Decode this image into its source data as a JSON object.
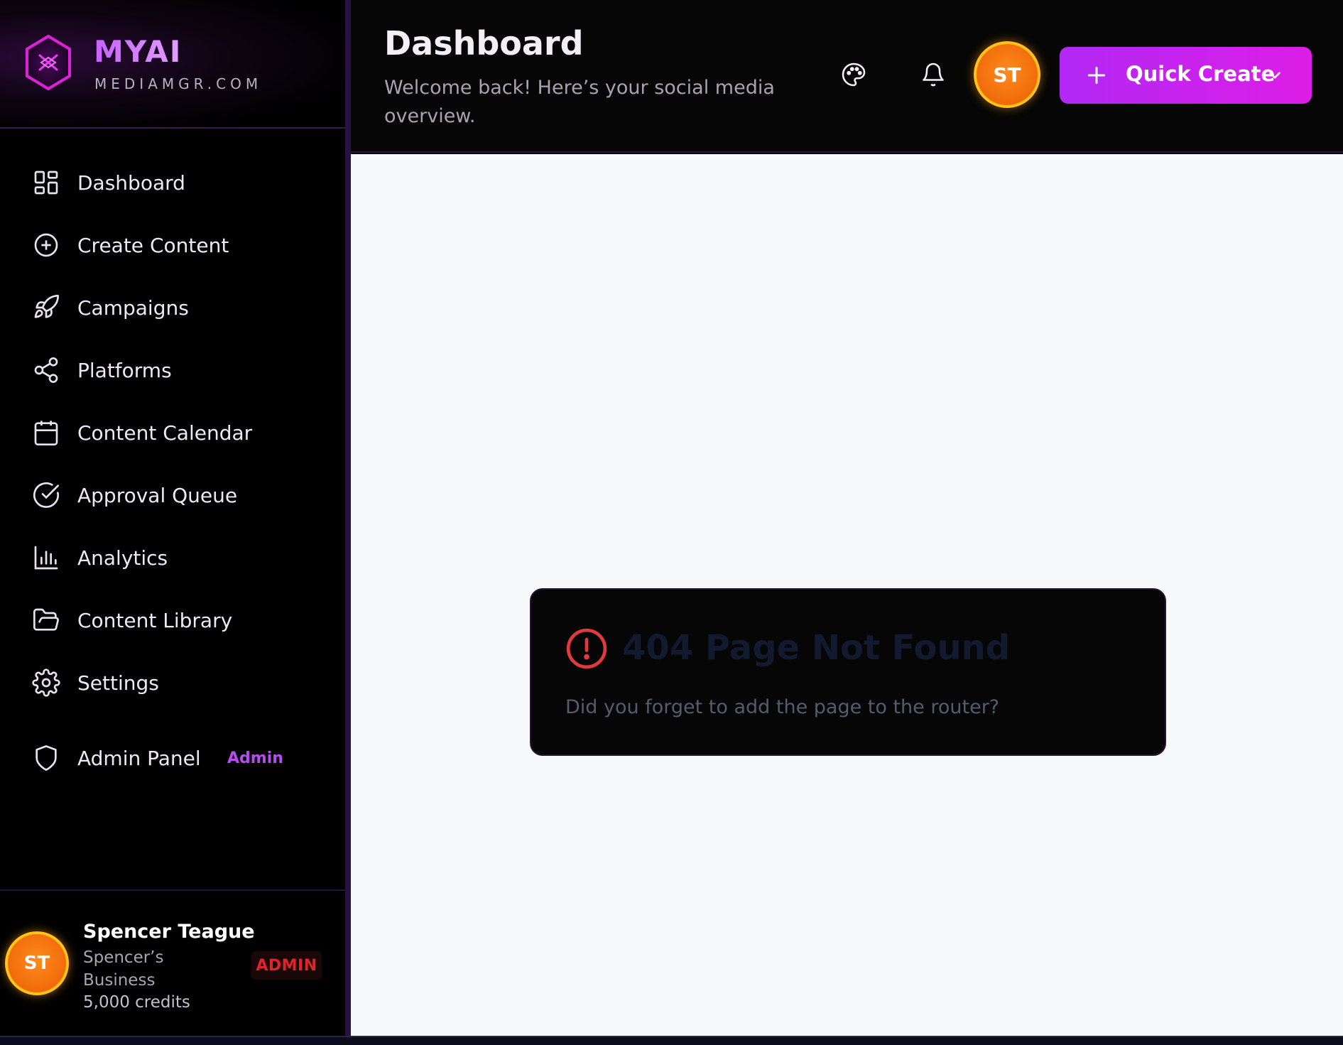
{
  "brand": {
    "name": "MYAI",
    "domain": "MEDIAMGR.COM"
  },
  "sidebar": {
    "items": [
      {
        "label": "Dashboard",
        "icon": "dashboard-grid-icon"
      },
      {
        "label": "Create Content",
        "icon": "plus-circle-icon"
      },
      {
        "label": "Campaigns",
        "icon": "rocket-icon"
      },
      {
        "label": "Platforms",
        "icon": "share-icon"
      },
      {
        "label": "Content Calendar",
        "icon": "calendar-icon"
      },
      {
        "label": "Approval Queue",
        "icon": "check-circle-icon"
      },
      {
        "label": "Analytics",
        "icon": "bar-chart-icon"
      },
      {
        "label": "Content Library",
        "icon": "folder-open-icon"
      },
      {
        "label": "Settings",
        "icon": "gear-icon"
      },
      {
        "label": "Admin Panel",
        "icon": "shield-icon",
        "badge": "Admin"
      }
    ]
  },
  "user": {
    "initials": "ST",
    "name": "Spencer Teague",
    "business": "Spencer’s Business",
    "credits": "5,000 credits",
    "role": "ADMIN"
  },
  "header": {
    "title": "Dashboard",
    "subtitle": "Welcome back! Here’s your social media overview.",
    "theme_icon": "palette-icon",
    "notifications_icon": "bell-icon",
    "avatar_initials": "ST",
    "quick_create_label": "Quick Create"
  },
  "error": {
    "title": "404 Page Not Found",
    "message": "Did you forget to add the page to the router?"
  },
  "colors": {
    "accent": "#c13af0",
    "avatar_ring": "#ffc21a",
    "avatar_fill": "#f06b0a",
    "error_red": "#e03a3e",
    "admin_badge": "#b84cf2"
  }
}
